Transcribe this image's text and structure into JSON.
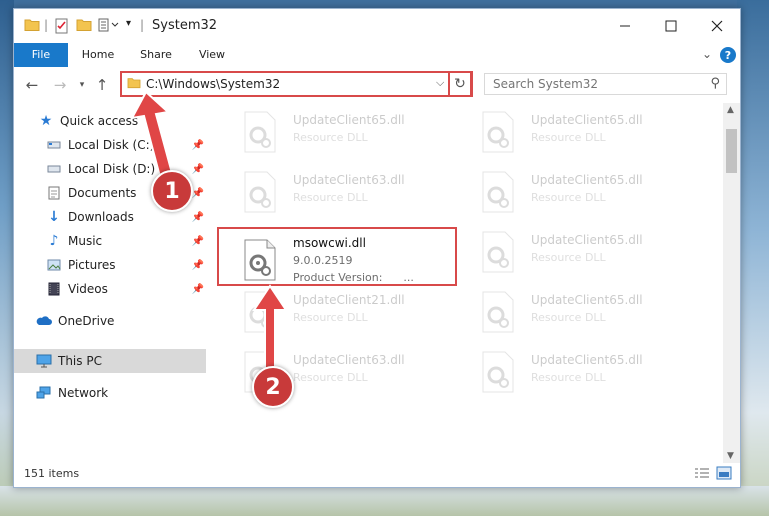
{
  "window": {
    "title": "System32"
  },
  "ribbon": {
    "tabs": [
      "File",
      "Home",
      "Share",
      "View"
    ]
  },
  "nav": {
    "address_path": "C:\\Windows\\System32",
    "search_placeholder": "Search System32"
  },
  "sidebar": {
    "items": [
      {
        "label": "Quick access",
        "icon": "star-icon"
      },
      {
        "label": "Local Disk (C:)",
        "icon": "drive-icon",
        "pinned": true
      },
      {
        "label": "Local Disk (D:)",
        "icon": "drive-icon",
        "pinned": true
      },
      {
        "label": "Documents",
        "icon": "document-icon",
        "pinned": true
      },
      {
        "label": "Downloads",
        "icon": "download-icon",
        "pinned": true
      },
      {
        "label": "Music",
        "icon": "music-icon",
        "pinned": true
      },
      {
        "label": "Pictures",
        "icon": "pictures-icon",
        "pinned": true
      },
      {
        "label": "Videos",
        "icon": "video-icon",
        "pinned": true
      },
      {
        "label": "OneDrive",
        "icon": "cloud-icon"
      },
      {
        "label": "This PC",
        "icon": "computer-icon",
        "selected": true
      },
      {
        "label": "Network",
        "icon": "network-icon"
      }
    ]
  },
  "files": {
    "left": [
      {
        "name": "UpdateClient65.dll",
        "line2": "Resource DLL",
        "line3": ""
      },
      {
        "name": "UpdateClient63.dll",
        "line2": "Resource DLL",
        "line3": ""
      },
      {
        "name": "msowcwi.dll",
        "line2": "9.0.0.2519",
        "line3": "Product Version:      ..."
      },
      {
        "name": "UpdateClient21.dll",
        "line2": "Resource DLL",
        "line3": ""
      },
      {
        "name": "UpdateClient63.dll",
        "line2": "Resource DLL",
        "line3": ""
      }
    ],
    "right": [
      {
        "name": "UpdateClient65.dll",
        "line2": "Resource DLL"
      },
      {
        "name": "UpdateClient65.dll",
        "line2": "Resource DLL"
      },
      {
        "name": "UpdateClient65.dll",
        "line2": "Resource DLL"
      },
      {
        "name": "UpdateClient65.dll",
        "line2": "Resource DLL"
      },
      {
        "name": "UpdateClient65.dll",
        "line2": "Resource DLL"
      }
    ]
  },
  "status": {
    "item_count": "151 items"
  },
  "callouts": {
    "one": "1",
    "two": "2"
  },
  "colors": {
    "accent": "#1979ca",
    "highlight": "#d84a4a",
    "callout": "#c83a3a"
  }
}
